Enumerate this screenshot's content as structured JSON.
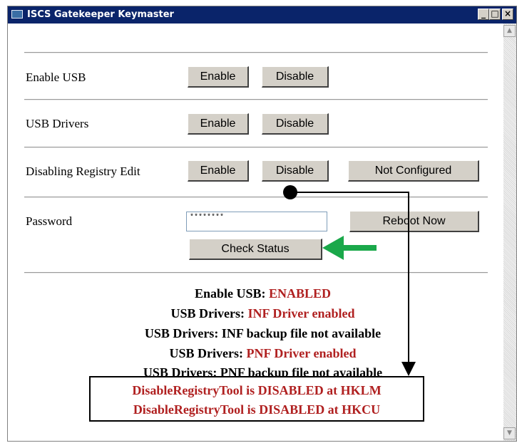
{
  "window": {
    "title": "ISCS Gatekeeper Keymaster",
    "controls": {
      "minimize": "_",
      "maximize": "□",
      "close": "×"
    }
  },
  "rows": {
    "enable_usb": {
      "label": "Enable USB",
      "enable": "Enable",
      "disable": "Disable"
    },
    "usb_drivers": {
      "label": "USB Drivers",
      "enable": "Enable",
      "disable": "Disable"
    },
    "registry_edit": {
      "label": "Disabling Registry Edit",
      "enable": "Enable",
      "disable": "Disable",
      "not_configured": "Not Configured"
    },
    "password": {
      "label": "Password",
      "value": "********",
      "reboot": "Reboot Now",
      "check_status": "Check Status"
    }
  },
  "status": [
    {
      "prefix": "Enable USB:",
      "value": "ENABLED"
    },
    {
      "prefix": "USB Drivers:",
      "value": "INF Driver enabled"
    },
    {
      "prefix": "USB Drivers: INF backup file not available",
      "value": ""
    },
    {
      "prefix": "USB Drivers:",
      "value": "PNF Driver enabled"
    },
    {
      "prefix": "USB Drivers: PNF backup file not available",
      "value": ""
    }
  ],
  "highlight_box": {
    "line1": "DisableRegistryTool is DISABLED at HKLM",
    "line2": "DisableRegistryTool is DISABLED at HKCU"
  },
  "colors": {
    "title_bar": "#0a246a",
    "status_value": "#b02020",
    "annotation_arrow": "#1aa84a"
  }
}
